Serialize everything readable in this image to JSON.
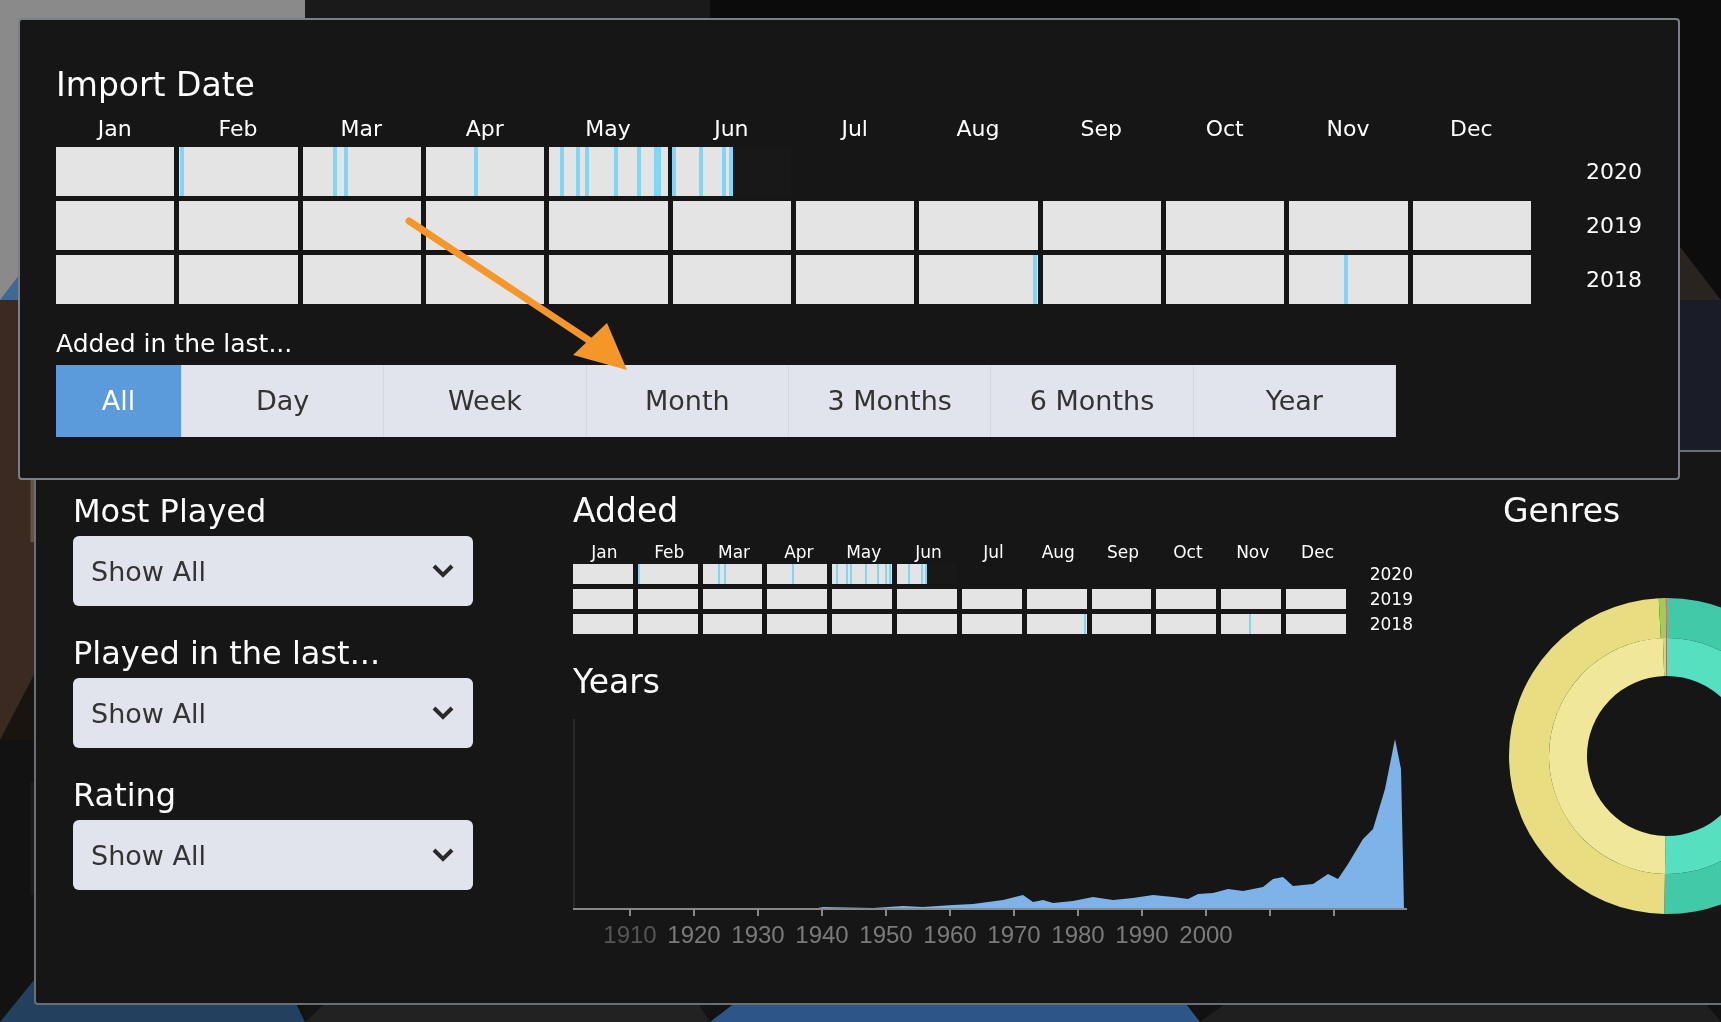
{
  "import_date": {
    "title": "Import Date",
    "months": [
      "Jan",
      "Feb",
      "Mar",
      "Apr",
      "May",
      "Jun",
      "Jul",
      "Aug",
      "Sep",
      "Oct",
      "Nov",
      "Dec"
    ],
    "years": [
      {
        "label": "2020",
        "cells": [
          {
            "level": 1
          },
          {
            "level": 1,
            "marks": [
              {
                "level": 0.02
              }
            ]
          },
          {
            "level": 1,
            "marks": [
              {
                "level": 0.27
              },
              {
                "level": 0.37
              }
            ]
          },
          {
            "level": 1,
            "marks": [
              {
                "level": 0.42
              }
            ]
          },
          {
            "level": 1,
            "marks": [
              {
                "level": 0.11
              },
              {
                "level": 0.24
              },
              {
                "level": 0.32
              },
              {
                "level": 0.56
              },
              {
                "level": 0.76
              },
              {
                "level": 0.9
              },
              {
                "level": 0.93
              }
            ]
          },
          {
            "level": 0.51,
            "marks": [
              {
                "level": 0.01
              },
              {
                "level": 0.24
              },
              {
                "level": 0.43
              },
              {
                "level": 0.49
              }
            ]
          }
        ]
      },
      {
        "label": "2019",
        "cells": [
          {
            "level": 1
          },
          {
            "level": 1
          },
          {
            "level": 1
          },
          {
            "level": 1
          },
          {
            "level": 1
          },
          {
            "level": 1
          },
          {
            "level": 1
          },
          {
            "level": 1
          },
          {
            "level": 1
          },
          {
            "level": 1
          },
          {
            "level": 1
          },
          {
            "level": 1
          }
        ]
      },
      {
        "label": "2018",
        "cells": [
          {
            "level": 1
          },
          {
            "level": 1
          },
          {
            "level": 1
          },
          {
            "level": 1
          },
          {
            "level": 1
          },
          {
            "level": 1
          },
          {
            "level": 1
          },
          {
            "level": 1,
            "marks": [
              {
                "level": 0.98
              }
            ]
          },
          {
            "level": 1
          },
          {
            "level": 1
          },
          {
            "level": 1,
            "marks": [
              {
                "level": 0.48
              }
            ]
          },
          {
            "level": 1
          }
        ]
      }
    ]
  },
  "added_filter": {
    "label": "Added in the last...",
    "options": [
      {
        "label": "All",
        "selected": true
      },
      {
        "label": "Day",
        "selected": false
      },
      {
        "label": "Week",
        "selected": false
      },
      {
        "label": "Month",
        "selected": false
      },
      {
        "label": "3 Months",
        "selected": false
      },
      {
        "label": "6 Months",
        "selected": false
      },
      {
        "label": "Year",
        "selected": false
      }
    ]
  },
  "filters": [
    {
      "label": "Most Played",
      "value": "Show All"
    },
    {
      "label": "Played in the last...",
      "value": "Show All"
    },
    {
      "label": "Rating",
      "value": "Show All"
    }
  ],
  "added": {
    "title": "Added",
    "months": [
      "Jan",
      "Feb",
      "Mar",
      "Apr",
      "May",
      "Jun",
      "Jul",
      "Aug",
      "Sep",
      "Oct",
      "Nov",
      "Dec"
    ],
    "years": [
      {
        "label": "2020",
        "cells": [
          {
            "level": 1
          },
          {
            "level": 1,
            "marks": [
              {
                "level": 0.02
              }
            ]
          },
          {
            "level": 1,
            "marks": [
              {
                "level": 0.27
              },
              {
                "level": 0.37
              }
            ]
          },
          {
            "level": 1,
            "marks": [
              {
                "level": 0.42
              }
            ]
          },
          {
            "level": 1,
            "marks": [
              {
                "level": 0.08
              },
              {
                "level": 0.24
              },
              {
                "level": 0.32
              },
              {
                "level": 0.56
              },
              {
                "level": 0.76
              },
              {
                "level": 0.89
              },
              {
                "level": 0.96
              }
            ]
          },
          {
            "level": 0.5,
            "marks": [
              {
                "level": 0.2
              },
              {
                "level": 0.42
              },
              {
                "level": 0.48
              }
            ]
          }
        ]
      },
      {
        "label": "2019",
        "cells": [
          {
            "level": 1
          },
          {
            "level": 1
          },
          {
            "level": 1
          },
          {
            "level": 1
          },
          {
            "level": 1
          },
          {
            "level": 1
          },
          {
            "level": 1
          },
          {
            "level": 1
          },
          {
            "level": 1
          },
          {
            "level": 1
          },
          {
            "level": 1
          },
          {
            "level": 1
          }
        ]
      },
      {
        "label": "2018",
        "cells": [
          {
            "level": 1
          },
          {
            "level": 1
          },
          {
            "level": 1
          },
          {
            "level": 1
          },
          {
            "level": 1
          },
          {
            "level": 1
          },
          {
            "level": 1
          },
          {
            "level": 1,
            "marks": [
              {
                "level": 0.98
              }
            ]
          },
          {
            "level": 1
          },
          {
            "level": 1
          },
          {
            "level": 1,
            "marks": [
              {
                "level": 0.48
              }
            ]
          },
          {
            "level": 1
          }
        ]
      }
    ]
  },
  "years": {
    "title": "Years",
    "axis_labels": [
      "1910",
      "1920",
      "1930",
      "1940",
      "1950",
      "1960",
      "1970",
      "1980",
      "1990",
      "2000"
    ]
  },
  "genres": {
    "title": "Genres"
  }
}
